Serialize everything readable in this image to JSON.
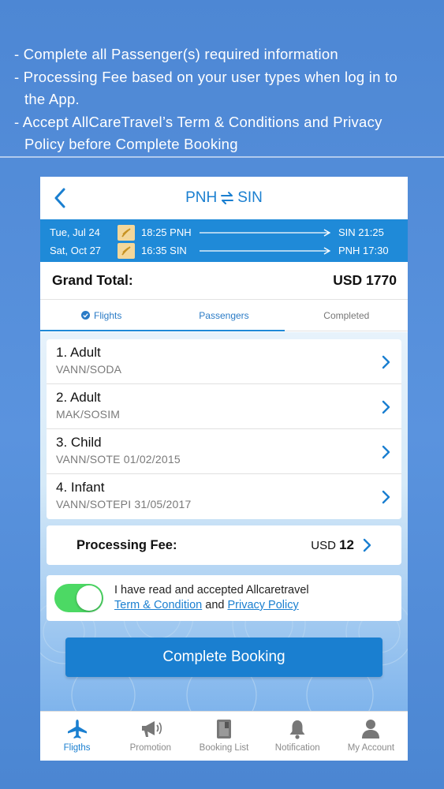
{
  "banner": {
    "lines": [
      "- Complete all Passenger(s) required information",
      "- Processing Fee based on your user types when log in to",
      "the App.",
      "- Accept AllCareTravel’s Term & Conditions and Privacy",
      "Policy before Complete Booking"
    ]
  },
  "header": {
    "origin": "PNH",
    "destination": "SIN"
  },
  "flights": [
    {
      "date": "Tue, Jul 24",
      "depart": "18:25 PNH",
      "arrive": "SIN 21:25"
    },
    {
      "date": "Sat, Oct 27",
      "depart": "16:35 SIN",
      "arrive": "PNH 17:30"
    }
  ],
  "grand_total": {
    "label": "Grand Total:",
    "value": "USD 1770"
  },
  "tabs": [
    "Flights",
    "Passengers",
    "Completed"
  ],
  "passengers": [
    {
      "title": "1. Adult",
      "name": "VANN/SODA"
    },
    {
      "title": "2. Adult",
      "name": "MAK/SOSIM"
    },
    {
      "title": "3. Child",
      "name": "VANN/SOTE 01/02/2015"
    },
    {
      "title": "4. Infant",
      "name": "VANN/SOTEPI 31/05/2017"
    }
  ],
  "processing_fee": {
    "label": "Processing Fee:",
    "currency": "USD",
    "amount": "12"
  },
  "terms": {
    "line1": "I have read and accepted Allcaretravel",
    "term_link": "Term & Condition",
    "and": "and",
    "privacy_link": "Privacy Policy",
    "accepted": true
  },
  "cta_label": "Complete Booking",
  "bottom_nav": [
    {
      "label": "Fligths",
      "icon": "airplane-icon"
    },
    {
      "label": "Promotion",
      "icon": "megaphone-icon"
    },
    {
      "label": "Booking List",
      "icon": "book-icon"
    },
    {
      "label": "Notification",
      "icon": "bell-icon"
    },
    {
      "label": "My Account",
      "icon": "person-icon"
    }
  ],
  "colors": {
    "primary": "#1a7fd0",
    "band": "#1f8ad8",
    "toggle_on": "#4cd964",
    "background": "#4d87d4"
  }
}
